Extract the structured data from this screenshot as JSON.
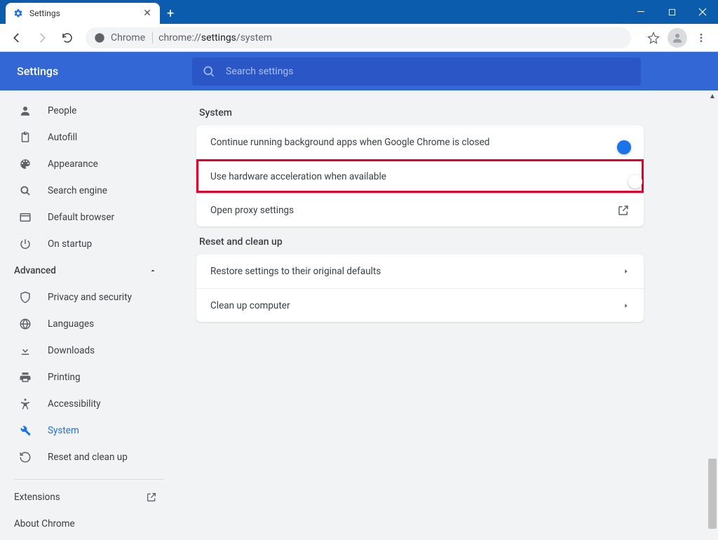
{
  "window": {
    "tab_title": "Settings"
  },
  "addressbar": {
    "chrome_label": "Chrome",
    "url_prefix": "chrome://",
    "url_mid": "settings",
    "url_suffix": "/system"
  },
  "header": {
    "title": "Settings",
    "search_placeholder": "Search settings"
  },
  "sidebar": {
    "items_main": [
      {
        "label": "People",
        "icon": "person"
      },
      {
        "label": "Autofill",
        "icon": "clipboard"
      },
      {
        "label": "Appearance",
        "icon": "palette"
      },
      {
        "label": "Search engine",
        "icon": "search"
      },
      {
        "label": "Default browser",
        "icon": "browser"
      },
      {
        "label": "On startup",
        "icon": "power"
      }
    ],
    "advanced_label": "Advanced",
    "items_adv": [
      {
        "label": "Privacy and security",
        "icon": "shield"
      },
      {
        "label": "Languages",
        "icon": "globe"
      },
      {
        "label": "Downloads",
        "icon": "download"
      },
      {
        "label": "Printing",
        "icon": "print"
      },
      {
        "label": "Accessibility",
        "icon": "accessibility"
      },
      {
        "label": "System",
        "icon": "wrench",
        "active": true
      },
      {
        "label": "Reset and clean up",
        "icon": "restore"
      }
    ],
    "extensions_label": "Extensions",
    "about_label": "About Chrome"
  },
  "content": {
    "system_label": "System",
    "system_rows": {
      "bg_apps": "Continue running background apps when Google Chrome is closed",
      "hw_accel": "Use hardware acceleration when available",
      "proxy": "Open proxy settings"
    },
    "reset_label": "Reset and clean up",
    "reset_rows": {
      "restore": "Restore settings to their original defaults",
      "cleanup": "Clean up computer"
    }
  }
}
